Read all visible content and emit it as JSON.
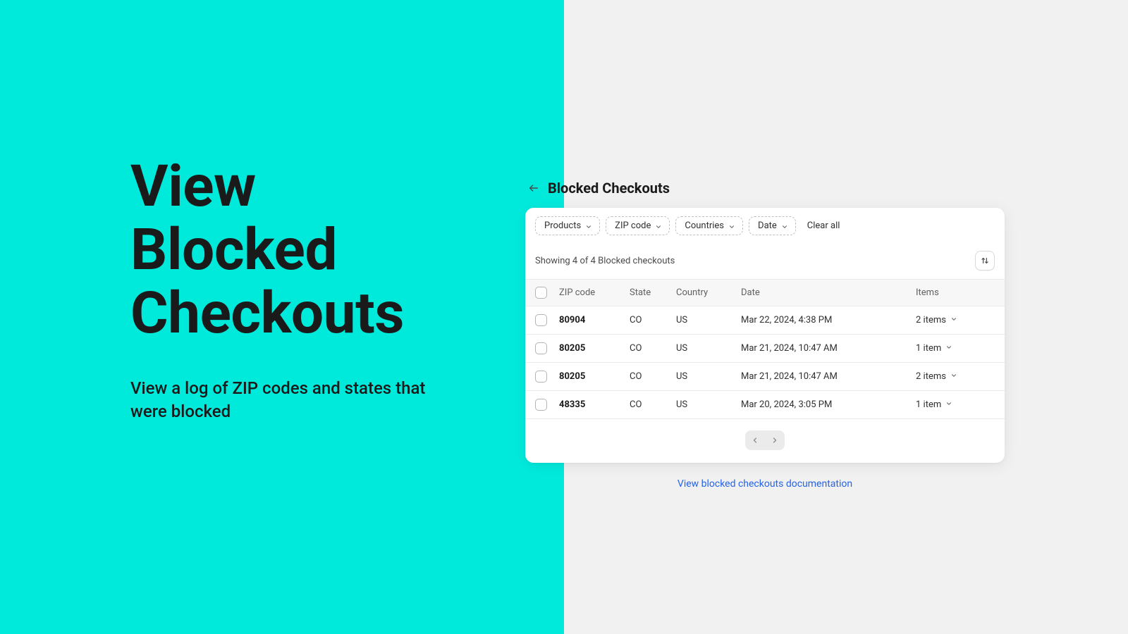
{
  "hero": {
    "title_line1": "View",
    "title_line2": "Blocked",
    "title_line3": "Checkouts",
    "subtitle": "View a log of ZIP codes and states that were blocked"
  },
  "header": {
    "title": "Blocked Checkouts"
  },
  "filters": {
    "products": "Products",
    "zipcode": "ZIP code",
    "countries": "Countries",
    "date": "Date",
    "clear_all": "Clear all"
  },
  "summary": "Showing 4 of 4 Blocked checkouts",
  "columns": {
    "zip": "ZIP code",
    "state": "State",
    "country": "Country",
    "date": "Date",
    "items": "Items"
  },
  "rows": [
    {
      "zip": "80904",
      "state": "CO",
      "country": "US",
      "date": "Mar 22, 2024, 4:38 PM",
      "items": "2 items"
    },
    {
      "zip": "80205",
      "state": "CO",
      "country": "US",
      "date": "Mar 21, 2024, 10:47 AM",
      "items": "1 item"
    },
    {
      "zip": "80205",
      "state": "CO",
      "country": "US",
      "date": "Mar 21, 2024, 10:47 AM",
      "items": "2 items"
    },
    {
      "zip": "48335",
      "state": "CO",
      "country": "US",
      "date": "Mar 20, 2024, 3:05 PM",
      "items": "1 item"
    }
  ],
  "doc_link": "View blocked checkouts documentation"
}
